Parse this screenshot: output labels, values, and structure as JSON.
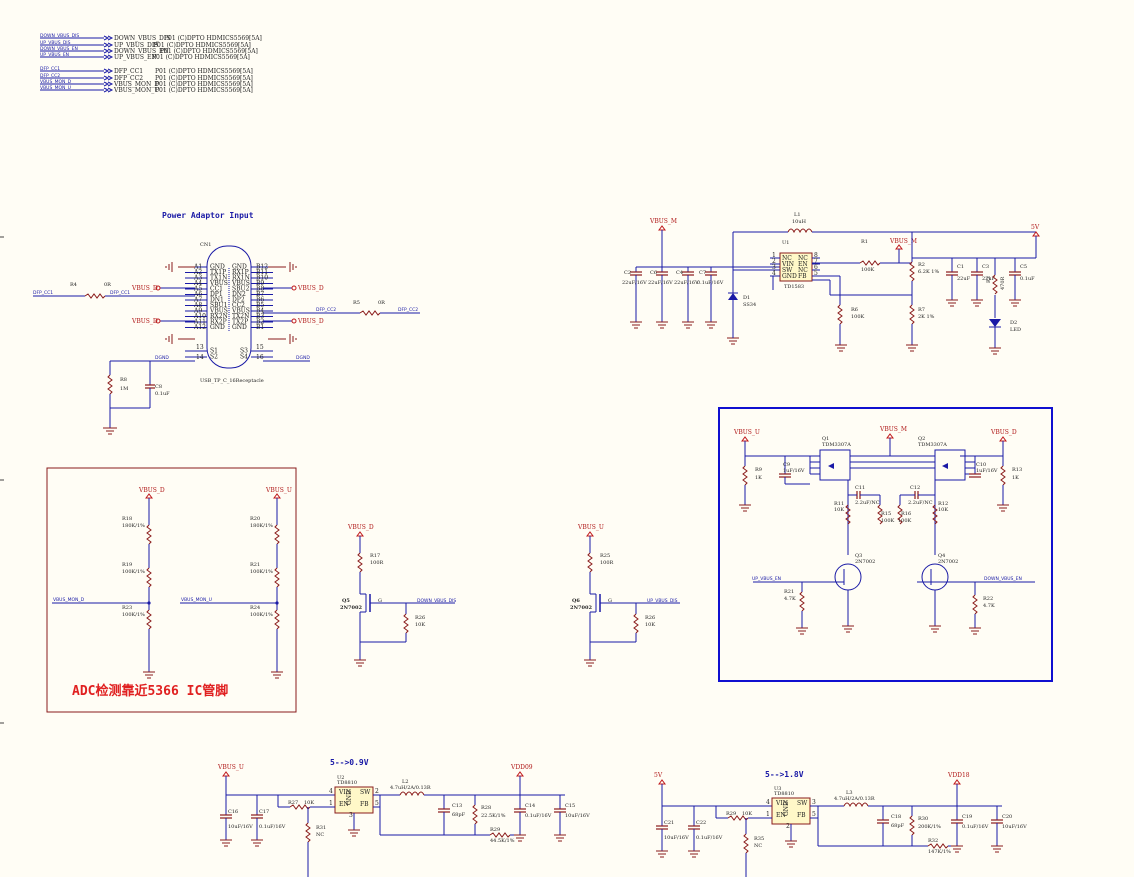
{
  "ports": [
    {
      "net": "DOWN_VBUS_DIS",
      "label": "DOWN_VBUS_DIS",
      "ref": "P01 (C)DPTO HDMICS5569[5A]"
    },
    {
      "net": "UP_VBUS_DIS",
      "label": "UP_VBUS_DIS",
      "ref": "P01 (C)DPTO HDMICS5569[5A]"
    },
    {
      "net": "DOWN_VBUS_EN",
      "label": "DOWN_VBUS_EN",
      "ref": "P01 (C)DPTO HDMICS5569[5A]"
    },
    {
      "net": "UP_VBUS_EN",
      "label": "UP_VBUS_EN",
      "ref": "P01 (C)DPTO HDMICS5569[5A]"
    },
    {
      "net": "DFP_CC1",
      "label": "DFP_CC1",
      "ref": "P01 (C)DPTO HDMICS5569[5A]"
    },
    {
      "net": "DFP_CC2",
      "label": "DFP_CC2",
      "ref": "P01 (C)DPTO HDMICS5569[5A]"
    },
    {
      "net": "VBUS_MON_D",
      "label": "VBUS_MON_D",
      "ref": "P01 (C)DPTO HDMICS5569[5A]"
    },
    {
      "net": "VBUS_MON_U",
      "label": "VBUS_MON_U",
      "ref": "P01 (C)DPTO HDMICS5569[5A]"
    }
  ],
  "power_adaptor": {
    "title": "Power Adaptor Input",
    "ref": "CN1",
    "part": "USB_TP_C_16Receptacle",
    "left_pins": [
      "A1",
      "A2",
      "A3",
      "A4",
      "A5",
      "A6",
      "A7",
      "A8",
      "A9",
      "A10",
      "A11",
      "A12"
    ],
    "left_names": [
      "GND",
      "TX1P",
      "TX1N",
      "VBUS",
      "CC1",
      "DP1",
      "DN1",
      "SBU1",
      "VBUS",
      "RX2N",
      "RX2P",
      "GND"
    ],
    "right_pins": [
      "B12",
      "B11",
      "B10",
      "B9",
      "B8",
      "B7",
      "B6",
      "B5",
      "B4",
      "B3",
      "B2",
      "B1"
    ],
    "right_names": [
      "GND",
      "RX1P",
      "RX1N",
      "VBUS",
      "SBU2",
      "DN2",
      "DP2",
      "CC2",
      "VBUS",
      "TX2N",
      "TX2P",
      "GND"
    ],
    "shell_left": [
      "S1",
      "S2"
    ],
    "shell_right": [
      "S3",
      "S4"
    ],
    "shell_pins": [
      "13",
      "14",
      "15",
      "16"
    ],
    "vbus_d": "VBUS_D",
    "dfp_cc1": "DFP_CC1",
    "dfp_cc2": "DFP_CC2",
    "r4": "R4",
    "r4v": "0R",
    "r5": "R5",
    "r5v": "0R",
    "r8": "R8",
    "r8v": "1M",
    "c8": "C8",
    "c8v": "0.1uF",
    "dgnd": "DGND"
  },
  "buck_top": {
    "vbus_m": "VBUS_M",
    "out": "5V",
    "l1": "L1",
    "l1v": "10uH",
    "u1": "U1",
    "u1p": "TD1583",
    "pins_l": [
      "NC",
      "VIN",
      "SW",
      "GND"
    ],
    "pins_r": [
      "NC",
      "EN",
      "NC",
      "FB"
    ],
    "pins_ln": [
      "1",
      "2",
      "3",
      "4"
    ],
    "pins_rn": [
      "8",
      "7",
      "6",
      "5"
    ],
    "r1": "R1",
    "r1v": "100K",
    "r6": "R6",
    "r6v": "100K",
    "r2": "R2",
    "r2v": "6.2K 1%",
    "r7": "R7",
    "r7v": "2K 1%",
    "caps": [
      {
        "r": "C2",
        "v": "22uF/16V"
      },
      {
        "r": "C6",
        "v": "22uF/16V"
      },
      {
        "r": "C4",
        "v": "22uF/16V"
      },
      {
        "r": "C7",
        "v": "0.1uF/16V"
      }
    ],
    "d1": "D1",
    "d1v": "SS34",
    "c1": "C1",
    "c1v": "22uF",
    "c3": "C3",
    "c3v": "22uF",
    "c5": "C5",
    "c5v": "0.1uF",
    "r3": "R3",
    "r3v": "470R",
    "d2": "D2",
    "d2v": "LED"
  },
  "switch": {
    "vbus_u": "VBUS_U",
    "vbus_m": "VBUS_M",
    "vbus_d": "VBUS_D",
    "q1": "Q1",
    "q1p": "TDM3307A",
    "q2": "Q2",
    "q2p": "TDM3307A",
    "r9": "R9",
    "r9v": "1K",
    "c9": "C9",
    "c9v": "1uF/16V",
    "c10": "C10",
    "c10v": "1uF/16V",
    "r13": "R13",
    "r13v": "1K",
    "c11": "C11",
    "c11v": "2.2uF/NC",
    "c12": "C12",
    "c12v": "2.2uF/NC",
    "r11": "R11",
    "r11v": "10K",
    "r15": "R15",
    "r15v": "100K",
    "r16": "R16",
    "r16v": "100K",
    "r12": "R12",
    "r12v": "10K",
    "q3": "Q3",
    "q3p": "2N7002",
    "q4": "Q4",
    "q4p": "2N7002",
    "up_en": "UP_VBUS_EN",
    "down_en": "DOWN_VBUS_EN",
    "r21": "R21",
    "r21v": "4.7K",
    "r22": "R22",
    "r22v": "4.7K"
  },
  "adc": {
    "vbus_d": "VBUS_D",
    "vbus_u": "VBUS_U",
    "r18": "R18",
    "r18v": "180K/1%",
    "r19": "R19",
    "r19v": "100K/1%",
    "r23": "R23",
    "r23v": "100K/1%",
    "r20": "R20",
    "r20v": "180K/1%",
    "r21": "R21",
    "r21v": "100K/1%",
    "r24": "R24",
    "r24v": "100K/1%",
    "mon_d": "VBUS_MON_D",
    "mon_u": "VBUS_MON_U",
    "note": "ADC检测靠近5366 IC管脚"
  },
  "discharge": [
    {
      "vbus": "VBUS_D",
      "r": "R17",
      "rv": "100R",
      "q": "Q5",
      "qp": "2N7002",
      "net": "DOWN_VBUS_DIS",
      "rg": "R26",
      "rgv": "10K",
      "g": "G"
    },
    {
      "vbus": "VBUS_U",
      "r": "R25",
      "rv": "100R",
      "q": "Q6",
      "qp": "2N7002",
      "net": "UP_VBUS_DIS",
      "rg": "R26",
      "rgv": "10K",
      "g": "G"
    }
  ],
  "reg09": {
    "title": "5-->0.9V",
    "vin": "VBUS_U",
    "vout": "VDD09",
    "u": "U2",
    "up": "TD8810",
    "pins": [
      "VIN",
      "SW",
      "EN",
      "FB",
      "GND"
    ],
    "pinnum": [
      "4",
      "2",
      "1",
      "5",
      "3"
    ],
    "l": "L2",
    "lv": "4.7uH/2A/0.13R",
    "r27": "R27",
    "r27v": "10K",
    "c16": "C16",
    "c16v": "10uF/16V",
    "c17": "C17",
    "c17v": "0.1uF/16V",
    "r31": "R31",
    "r31v": "NC",
    "c13": "C13",
    "c13v": "68pF",
    "r28": "R28",
    "r28v": "22.5K/1%",
    "r29": "R29",
    "r29v": "44.5K/1%",
    "c14": "C14",
    "c14v": "0.1uF/16V",
    "c15": "C15",
    "c15v": "10uF/16V"
  },
  "reg18": {
    "title": "5-->1.8V",
    "vin": "5V",
    "vout": "VDD18",
    "u": "U3",
    "up": "TD8810",
    "pins": [
      "VIN",
      "SW",
      "EN",
      "FB",
      "GND"
    ],
    "pinnum": [
      "4",
      "3",
      "1",
      "5",
      "2"
    ],
    "l": "L3",
    "lv": "4.7uH/2A/0.13R",
    "r29": "R29",
    "r29v": "10K",
    "c21": "C21",
    "c21v": "10uF/16V",
    "c22": "C22",
    "c22v": "0.1uF/16V",
    "r35": "R35",
    "r35v": "NC",
    "c18": "C18",
    "c18v": "68pF",
    "r30": "R30",
    "r30v": "200K/1%",
    "r32": "R32",
    "r32v": "147K/1%",
    "c19": "C19",
    "c19v": "0.1uF/16V",
    "c20": "C20",
    "c20v": "10uF/16V"
  },
  "colors": {
    "wire": "#1a1aa6",
    "net": "#c0191c",
    "part": "#8a1a1a",
    "highlight": "#1010d0",
    "note": "#e02020"
  }
}
